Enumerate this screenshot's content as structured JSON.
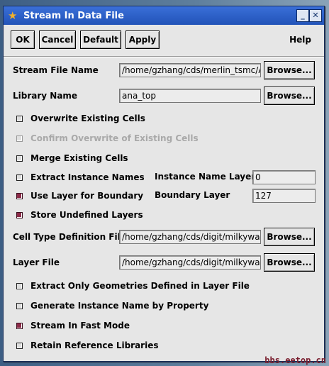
{
  "window": {
    "title": "Stream In Data File",
    "min_glyph": "_",
    "close_glyph": "✕"
  },
  "toolbar": {
    "ok": "OK",
    "cancel": "Cancel",
    "default": "Default",
    "apply": "Apply",
    "help": "Help"
  },
  "fields": {
    "stream_file": {
      "label": "Stream File Name",
      "value": "/home/gzhang/cds/merlin_tsmc/AN",
      "browse": "Browse..."
    },
    "library": {
      "label": "Library Name",
      "value": "ana_top",
      "browse": "Browse..."
    },
    "instance_layer": {
      "label": "Instance Name Layer",
      "value": "0"
    },
    "boundary_layer": {
      "label": "Boundary Layer",
      "value": "127"
    },
    "cell_type": {
      "label": "Cell Type Definition File",
      "value": "/home/gzhang/cds/digit/milkyway/g",
      "browse": "Browse..."
    },
    "layer_file": {
      "label": "Layer File",
      "value": "/home/gzhang/cds/digit/milkyway/g",
      "browse": "Browse..."
    }
  },
  "checks": {
    "overwrite": {
      "label": "Overwrite Existing Cells",
      "checked": false
    },
    "confirm_overwrite": {
      "label": "Confirm Overwrite of Existing Cells",
      "checked": false,
      "disabled": true
    },
    "merge": {
      "label": "Merge Existing Cells",
      "checked": false
    },
    "extract_names": {
      "label": "Extract Instance Names",
      "checked": false
    },
    "use_layer_boundary": {
      "label": "Use Layer for Boundary",
      "checked": true
    },
    "store_undefined": {
      "label": "Store Undefined Layers",
      "checked": true
    },
    "extract_only": {
      "label": "Extract Only Geometries Defined in Layer File",
      "checked": false
    },
    "generate_name": {
      "label": "Generate Instance Name by Property",
      "checked": false
    },
    "fast_mode": {
      "label": "Stream In Fast Mode",
      "checked": true
    },
    "retain_libs": {
      "label": "Retain Reference Libraries",
      "checked": false
    }
  },
  "watermark": "bbs.eetop.cn",
  "colors": {
    "title_bar": "#2a5cc4",
    "checked": "#8c2a48",
    "dialog_bg": "#e6e6e6"
  }
}
